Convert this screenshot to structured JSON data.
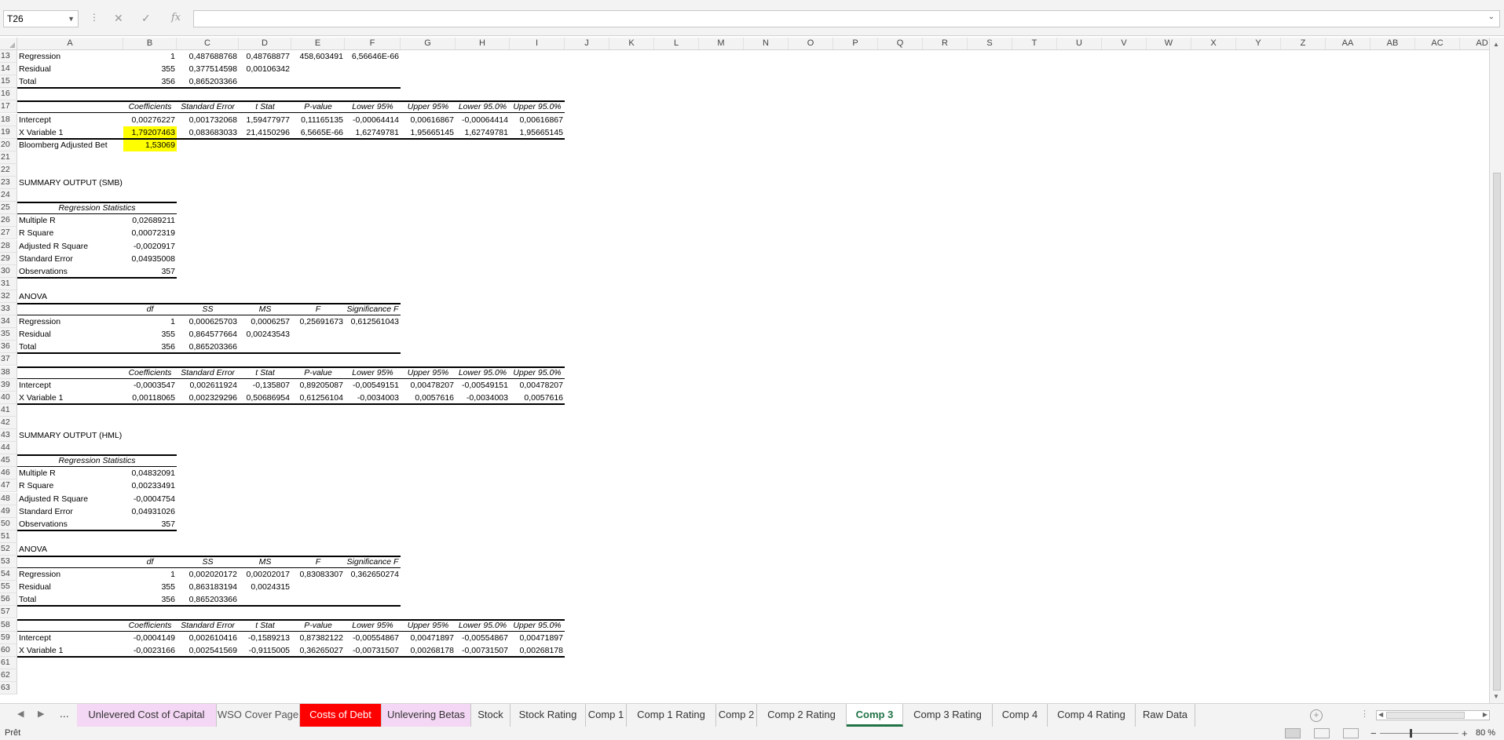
{
  "formula_bar": {
    "name_box": "T26",
    "formula": ""
  },
  "column_headers": [
    "A",
    "B",
    "C",
    "D",
    "E",
    "F",
    "G",
    "H",
    "I",
    "J",
    "K",
    "L",
    "M",
    "N",
    "O",
    "P",
    "Q",
    "R",
    "S",
    "T",
    "U",
    "V",
    "W",
    "X",
    "Y",
    "Z",
    "AA",
    "AB",
    "AC",
    "AD"
  ],
  "rows": {
    "13": {
      "A": "Regression",
      "B": "1",
      "C": "0,487688768",
      "D": "0,48768877",
      "E": "458,603491",
      "F": "6,56646E-66"
    },
    "14": {
      "A": "Residual",
      "B": "355",
      "C": "0,377514598",
      "D": "0,00106342"
    },
    "15": {
      "A": "Total",
      "B": "356",
      "C": "0,865203366"
    },
    "16": {},
    "17": {
      "B": "Coefficients",
      "C": "Standard Error",
      "D": "t Stat",
      "E": "P-value",
      "F": "Lower 95%",
      "G": "Upper 95%",
      "H": "Lower 95.0%",
      "I": "Upper 95.0%"
    },
    "18": {
      "A": "Intercept",
      "B": "0,00276227",
      "C": "0,001732068",
      "D": "1,59477977",
      "E": "0,11165135",
      "F": "-0,00064414",
      "G": "0,00616867",
      "H": "-0,00064414",
      "I": "0,00616867"
    },
    "19": {
      "A": "X Variable 1",
      "B": "1,79207463",
      "C": "0,083683033",
      "D": "21,4150296",
      "E": "6,5665E-66",
      "F": "1,62749781",
      "G": "1,95665145",
      "H": "1,62749781",
      "I": "1,95665145"
    },
    "20": {
      "A": "Bloomberg Adjusted Bet",
      "B": "1,53069"
    },
    "21": {},
    "22": {},
    "23": {
      "A": "SUMMARY OUTPUT (SMB)"
    },
    "24": {},
    "25": {
      "AB": "Regression Statistics"
    },
    "26": {
      "A": "Multiple R",
      "B": "0,02689211"
    },
    "27": {
      "A": "R Square",
      "B": "0,00072319"
    },
    "28": {
      "A": "Adjusted R Square",
      "B": "-0,0020917"
    },
    "29": {
      "A": "Standard Error",
      "B": "0,04935008"
    },
    "30": {
      "A": "Observations",
      "B": "357"
    },
    "31": {},
    "32": {
      "A": "ANOVA"
    },
    "33": {
      "B": "df",
      "C": "SS",
      "D": "MS",
      "E": "F",
      "F": "Significance F"
    },
    "34": {
      "A": "Regression",
      "B": "1",
      "C": "0,000625703",
      "D": "0,0006257",
      "E": "0,25691673",
      "F": "0,612561043"
    },
    "35": {
      "A": "Residual",
      "B": "355",
      "C": "0,864577664",
      "D": "0,00243543"
    },
    "36": {
      "A": "Total",
      "B": "356",
      "C": "0,865203366"
    },
    "37": {},
    "38": {
      "B": "Coefficients",
      "C": "Standard Error",
      "D": "t Stat",
      "E": "P-value",
      "F": "Lower 95%",
      "G": "Upper 95%",
      "H": "Lower 95.0%",
      "I": "Upper 95.0%"
    },
    "39": {
      "A": "Intercept",
      "B": "-0,0003547",
      "C": "0,002611924",
      "D": "-0,135807",
      "E": "0,89205087",
      "F": "-0,00549151",
      "G": "0,00478207",
      "H": "-0,00549151",
      "I": "0,00478207"
    },
    "40": {
      "A": "X Variable 1",
      "B": "0,00118065",
      "C": "0,002329296",
      "D": "0,50686954",
      "E": "0,61256104",
      "F": "-0,0034003",
      "G": "0,0057616",
      "H": "-0,0034003",
      "I": "0,0057616"
    },
    "41": {},
    "42": {},
    "43": {
      "A": "SUMMARY OUTPUT (HML)"
    },
    "44": {},
    "45": {
      "AB": "Regression Statistics"
    },
    "46": {
      "A": "Multiple R",
      "B": "0,04832091"
    },
    "47": {
      "A": "R Square",
      "B": "0,00233491"
    },
    "48": {
      "A": "Adjusted R Square",
      "B": "-0,0004754"
    },
    "49": {
      "A": "Standard Error",
      "B": "0,04931026"
    },
    "50": {
      "A": "Observations",
      "B": "357"
    },
    "51": {},
    "52": {
      "A": "ANOVA"
    },
    "53": {
      "B": "df",
      "C": "SS",
      "D": "MS",
      "E": "F",
      "F": "Significance F"
    },
    "54": {
      "A": "Regression",
      "B": "1",
      "C": "0,002020172",
      "D": "0,00202017",
      "E": "0,83083307",
      "F": "0,362650274"
    },
    "55": {
      "A": "Residual",
      "B": "355",
      "C": "0,863183194",
      "D": "0,0024315"
    },
    "56": {
      "A": "Total",
      "B": "356",
      "C": "0,865203366"
    },
    "57": {},
    "58": {
      "B": "Coefficients",
      "C": "Standard Error",
      "D": "t Stat",
      "E": "P-value",
      "F": "Lower 95%",
      "G": "Upper 95%",
      "H": "Lower 95.0%",
      "I": "Upper 95.0%"
    },
    "59": {
      "A": "Intercept",
      "B": "-0,0004149",
      "C": "0,002610416",
      "D": "-0,1589213",
      "E": "0,87382122",
      "F": "-0,00554867",
      "G": "0,00471897",
      "H": "-0,00554867",
      "I": "0,00471897"
    },
    "60": {
      "A": "X Variable 1",
      "B": "-0,0023166",
      "C": "0,002541569",
      "D": "-0,9115005",
      "E": "0,36265027",
      "F": "-0,00731507",
      "G": "0,00268178",
      "H": "-0,00731507",
      "I": "0,00268178"
    },
    "61": {},
    "62": {},
    "63": {}
  },
  "highlight_color": "#ffff00",
  "sheet_tabs": [
    {
      "label": "Unlevered Cost of Capital",
      "color": "pink"
    },
    {
      "label": "WSO Cover Page",
      "color": "gray"
    },
    {
      "label": "Costs of Debt",
      "color": "red"
    },
    {
      "label": "Unlevering Betas",
      "color": "pink"
    },
    {
      "label": "Stock",
      "color": "none"
    },
    {
      "label": "Stock Rating",
      "color": "none"
    },
    {
      "label": "Comp 1",
      "color": "none"
    },
    {
      "label": "Comp 1 Rating",
      "color": "none"
    },
    {
      "label": "Comp 2",
      "color": "none"
    },
    {
      "label": "Comp 2 Rating",
      "color": "none"
    },
    {
      "label": "Comp 3",
      "color": "active"
    },
    {
      "label": "Comp 3 Rating",
      "color": "none"
    },
    {
      "label": "Comp 4",
      "color": "none"
    },
    {
      "label": "Comp 4 Rating",
      "color": "none"
    },
    {
      "label": "Raw Data",
      "color": "none"
    }
  ],
  "tab_overflow": "...",
  "status": {
    "text": "Prêt",
    "zoom": "80 %"
  }
}
